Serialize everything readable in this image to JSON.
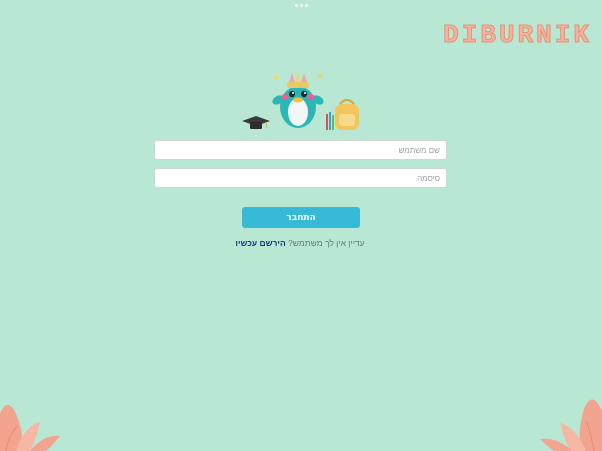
{
  "app": {
    "logo_text": "DIBURNIK"
  },
  "login_form": {
    "username_placeholder": "שם משתמש",
    "password_placeholder": "סיסמה",
    "login_button_label": "התחבר",
    "no_account_text": "עדיין אין לך משתמש?",
    "register_link_label": "הירשם עכשיו"
  },
  "colors": {
    "background": "#b8e8d4",
    "button": "#37b9d8",
    "logo": "#f2b49e",
    "link": "#123a86"
  },
  "icons": [
    "mascot-illustration",
    "graduation-cap-icon",
    "backpack-icon",
    "flower-decoration"
  ]
}
